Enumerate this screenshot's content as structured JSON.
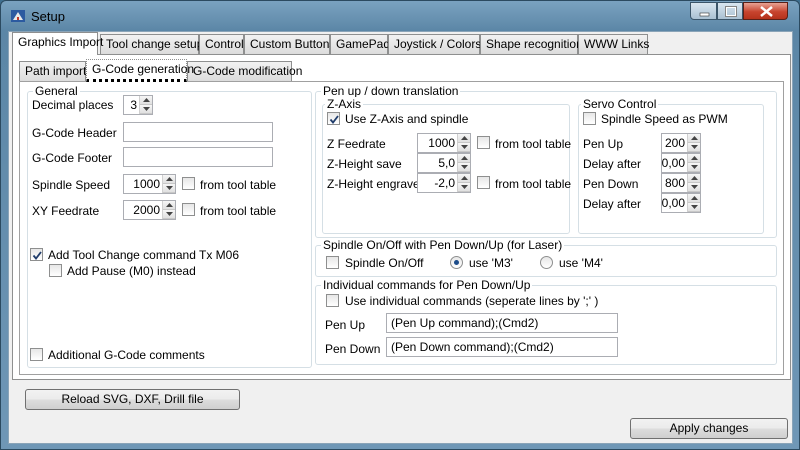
{
  "window": {
    "title": "Setup",
    "icon": "app-icon"
  },
  "main_tabs": [
    {
      "label": "Graphics Import",
      "active": true
    },
    {
      "label": "Tool change setup"
    },
    {
      "label": "Control"
    },
    {
      "label": "Custom Buttons"
    },
    {
      "label": "GamePad"
    },
    {
      "label": "Joystick / Colors"
    },
    {
      "label": "Shape recognition"
    },
    {
      "label": "WWW Links"
    }
  ],
  "sub_tabs": [
    {
      "label": "Path import"
    },
    {
      "label": "G-Code generation",
      "active": true
    },
    {
      "label": "G-Code modification"
    }
  ],
  "general": {
    "legend": "General",
    "decimal_places_label": "Decimal places",
    "decimal_places_value": "3",
    "header_label": "G-Code Header",
    "header_value": "",
    "footer_label": "G-Code Footer",
    "footer_value": "",
    "spindle_label": "Spindle Speed",
    "spindle_value": "1000",
    "spindle_from_tool": "from tool table",
    "xy_label": "XY Feedrate",
    "xy_value": "2000",
    "xy_from_tool": "from tool table",
    "tool_change_label": "Add Tool Change command Tx M06",
    "tool_change_checked": true,
    "pause_label": "Add Pause (M0) instead",
    "pause_checked": false,
    "comments_label": "Additional G-Code comments",
    "comments_checked": false
  },
  "pen": {
    "legend": "Pen up / down translation",
    "zaxis": {
      "legend": "Z-Axis",
      "use_label": "Use Z-Axis and spindle",
      "use_checked": true,
      "feed_label": "Z Feedrate",
      "feed_value": "1000",
      "feed_from_tool": "from tool table",
      "save_label": "Z-Height save",
      "save_value": "5,0",
      "engrave_label": "Z-Height engrave",
      "engrave_value": "-2,0",
      "engrave_from_tool": "from tool table"
    },
    "servo": {
      "legend": "Servo Control",
      "pwm_label": "Spindle Speed as PWM",
      "pwm_checked": false,
      "pen_up_label": "Pen Up",
      "pen_up_value": "200",
      "delay1_label": "Delay after",
      "delay1_value": "0,00",
      "pen_down_label": "Pen Down",
      "pen_down_value": "800",
      "delay2_label": "Delay after",
      "delay2_value": "0,00"
    }
  },
  "laser": {
    "legend": "Spindle On/Off with Pen Down/Up (for Laser)",
    "onoff_label": "Spindle On/Off",
    "onoff_checked": false,
    "m3_label": "use 'M3'",
    "m3_selected": true,
    "m4_label": "use 'M4'",
    "m4_selected": false
  },
  "individual": {
    "legend": "Individual commands for Pen Down/Up",
    "use_label": "Use individual commands (seperate lines by ';' )",
    "use_checked": false,
    "pen_up_label": "Pen Up",
    "pen_up_value": "(Pen Up command);(Cmd2)",
    "pen_down_label": "Pen Down",
    "pen_down_value": "(Pen Down command);(Cmd2)"
  },
  "buttons": {
    "reload": "Reload SVG, DXF, Drill file",
    "apply": "Apply changes"
  }
}
